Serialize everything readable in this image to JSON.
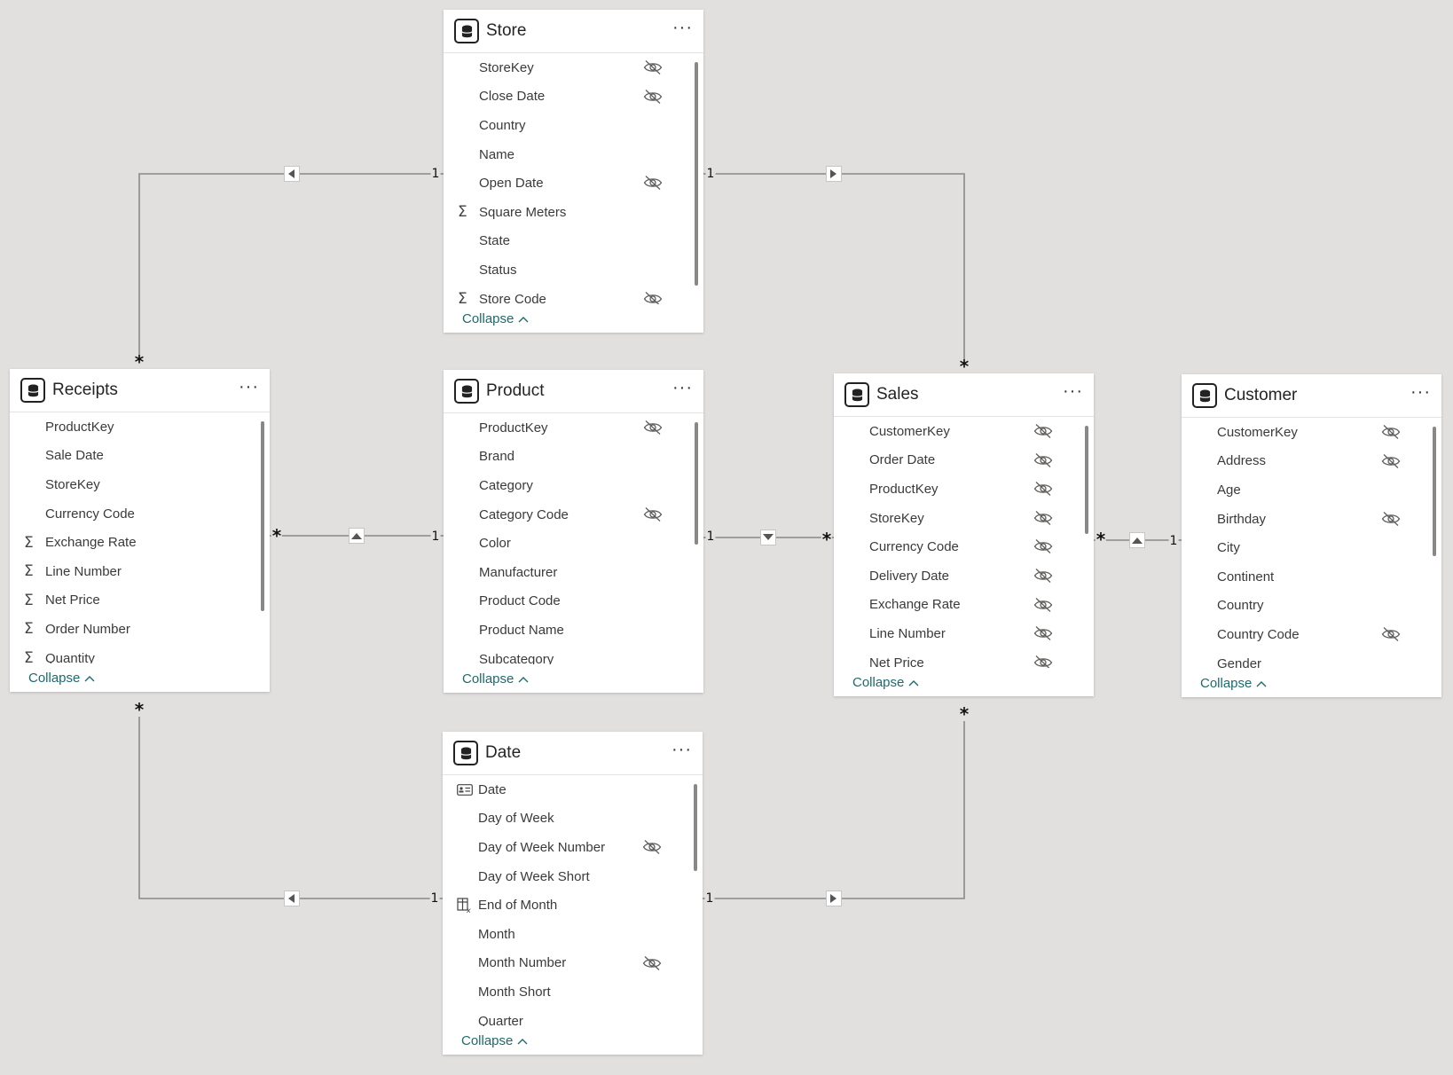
{
  "tables": {
    "store": {
      "title": "Store",
      "more": "···",
      "collapse": "Collapse",
      "fields": [
        {
          "label": "StoreKey",
          "icon": "",
          "hidden": true
        },
        {
          "label": "Close Date",
          "icon": "",
          "hidden": true
        },
        {
          "label": "Country",
          "icon": "",
          "hidden": false
        },
        {
          "label": "Name",
          "icon": "",
          "hidden": false
        },
        {
          "label": "Open Date",
          "icon": "",
          "hidden": true
        },
        {
          "label": "Square Meters",
          "icon": "sum-icon",
          "hidden": false
        },
        {
          "label": "State",
          "icon": "",
          "hidden": false
        },
        {
          "label": "Status",
          "icon": "",
          "hidden": false
        },
        {
          "label": "Store Code",
          "icon": "sum-icon",
          "hidden": true
        }
      ]
    },
    "receipts": {
      "title": "Receipts",
      "more": "···",
      "collapse": "Collapse",
      "fields": [
        {
          "label": "ProductKey",
          "icon": "",
          "hidden": false
        },
        {
          "label": "Sale Date",
          "icon": "",
          "hidden": false
        },
        {
          "label": "StoreKey",
          "icon": "",
          "hidden": false
        },
        {
          "label": "Currency Code",
          "icon": "",
          "hidden": false
        },
        {
          "label": "Exchange Rate",
          "icon": "sum-icon",
          "hidden": false
        },
        {
          "label": "Line Number",
          "icon": "sum-icon",
          "hidden": false
        },
        {
          "label": "Net Price",
          "icon": "sum-icon",
          "hidden": false
        },
        {
          "label": "Order Number",
          "icon": "sum-icon",
          "hidden": false
        },
        {
          "label": "Quantity",
          "icon": "sum-icon",
          "hidden": false
        }
      ]
    },
    "product": {
      "title": "Product",
      "more": "···",
      "collapse": "Collapse",
      "fields": [
        {
          "label": "ProductKey",
          "icon": "",
          "hidden": true
        },
        {
          "label": "Brand",
          "icon": "",
          "hidden": false
        },
        {
          "label": "Category",
          "icon": "",
          "hidden": false
        },
        {
          "label": "Category Code",
          "icon": "",
          "hidden": true
        },
        {
          "label": "Color",
          "icon": "",
          "hidden": false
        },
        {
          "label": "Manufacturer",
          "icon": "",
          "hidden": false
        },
        {
          "label": "Product Code",
          "icon": "",
          "hidden": false
        },
        {
          "label": "Product Name",
          "icon": "",
          "hidden": false
        },
        {
          "label": "Subcategory",
          "icon": "",
          "hidden": false
        }
      ]
    },
    "sales": {
      "title": "Sales",
      "more": "···",
      "collapse": "Collapse",
      "fields": [
        {
          "label": "CustomerKey",
          "icon": "",
          "hidden": true
        },
        {
          "label": "Order Date",
          "icon": "",
          "hidden": true
        },
        {
          "label": "ProductKey",
          "icon": "",
          "hidden": true
        },
        {
          "label": "StoreKey",
          "icon": "",
          "hidden": true
        },
        {
          "label": "Currency Code",
          "icon": "",
          "hidden": true
        },
        {
          "label": "Delivery Date",
          "icon": "",
          "hidden": true
        },
        {
          "label": "Exchange Rate",
          "icon": "",
          "hidden": true
        },
        {
          "label": "Line Number",
          "icon": "",
          "hidden": true
        },
        {
          "label": "Net Price",
          "icon": "",
          "hidden": true
        }
      ]
    },
    "customer": {
      "title": "Customer",
      "more": "···",
      "collapse": "Collapse",
      "fields": [
        {
          "label": "CustomerKey",
          "icon": "",
          "hidden": true
        },
        {
          "label": "Address",
          "icon": "",
          "hidden": true
        },
        {
          "label": "Age",
          "icon": "",
          "hidden": false
        },
        {
          "label": "Birthday",
          "icon": "",
          "hidden": true
        },
        {
          "label": "City",
          "icon": "",
          "hidden": false
        },
        {
          "label": "Continent",
          "icon": "",
          "hidden": false
        },
        {
          "label": "Country",
          "icon": "",
          "hidden": false
        },
        {
          "label": "Country Code",
          "icon": "",
          "hidden": true
        },
        {
          "label": "Gender",
          "icon": "",
          "hidden": false
        }
      ]
    },
    "date": {
      "title": "Date",
      "more": "···",
      "collapse": "Collapse",
      "fields": [
        {
          "label": "Date",
          "icon": "id-card-icon",
          "hidden": false
        },
        {
          "label": "Day of Week",
          "icon": "",
          "hidden": false
        },
        {
          "label": "Day of Week Number",
          "icon": "",
          "hidden": true
        },
        {
          "label": "Day of Week Short",
          "icon": "",
          "hidden": false
        },
        {
          "label": "End of Month",
          "icon": "calculated-column-icon",
          "hidden": false
        },
        {
          "label": "Month",
          "icon": "",
          "hidden": false
        },
        {
          "label": "Month Number",
          "icon": "",
          "hidden": true
        },
        {
          "label": "Month Short",
          "icon": "",
          "hidden": false
        },
        {
          "label": "Quarter",
          "icon": "",
          "hidden": false
        }
      ]
    }
  },
  "relationships": [
    {
      "from": "Store",
      "to": "Receipts",
      "from_card": "1",
      "to_card": "*",
      "direction": "left"
    },
    {
      "from": "Store",
      "to": "Sales",
      "from_card": "1",
      "to_card": "*",
      "direction": "right"
    },
    {
      "from": "Product",
      "to": "Receipts",
      "from_card": "1",
      "to_card": "*",
      "direction": "up"
    },
    {
      "from": "Product",
      "to": "Sales",
      "from_card": "1",
      "to_card": "*",
      "direction": "down"
    },
    {
      "from": "Customer",
      "to": "Sales",
      "from_card": "1",
      "to_card": "*",
      "direction": "up"
    },
    {
      "from": "Date",
      "to": "Receipts",
      "from_card": "1",
      "to_card": "*",
      "direction": "left"
    },
    {
      "from": "Date",
      "to": "Sales",
      "from_card": "1",
      "to_card": "*",
      "direction": "right"
    }
  ],
  "colors": {
    "canvas": "#e1e0df",
    "card": "#ffffff",
    "line": "#8a8886",
    "collapse_link": "#1c6b6e"
  }
}
